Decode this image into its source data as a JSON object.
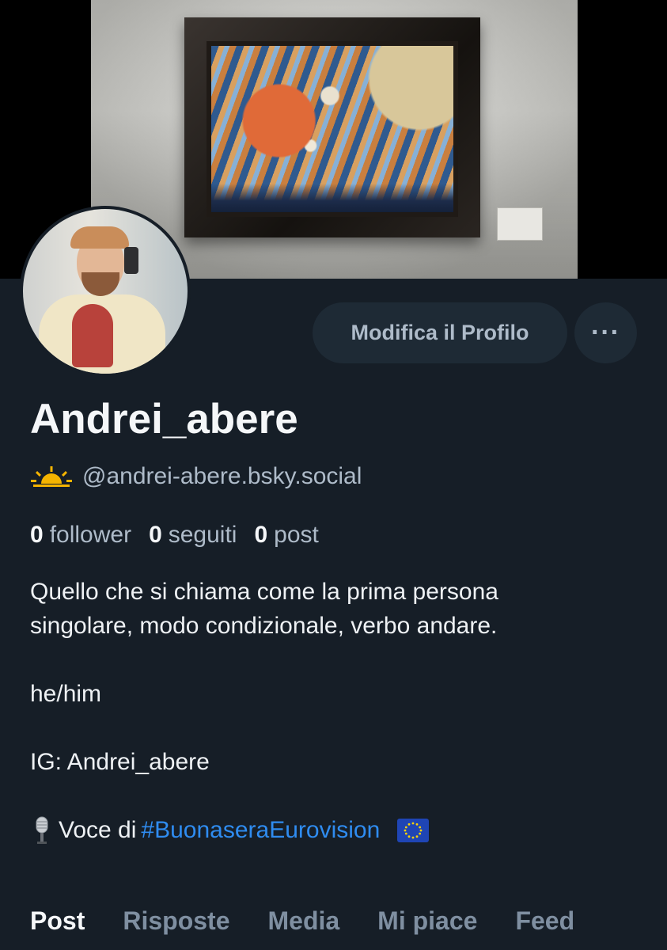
{
  "profile": {
    "display_name": "Andrei_abere",
    "handle": "@andrei-abere.bsky.social",
    "stats": [
      {
        "value": "0",
        "label": "follower"
      },
      {
        "value": "0",
        "label": "seguiti"
      },
      {
        "value": "0",
        "label": "post"
      }
    ],
    "bio": {
      "line1": "Quello che si chiama come la prima persona",
      "line2": "singolare, modo condizionale, verbo andare.",
      "pronouns": "he/him",
      "instagram": "IG: Andrei_abere",
      "voice_prefix": "Voce di",
      "hashtag": "#BuonaseraEurovision"
    }
  },
  "actions": {
    "edit_profile_label": "Modifica il Profilo",
    "more_label": "···"
  },
  "tabs": [
    "Post",
    "Risposte",
    "Media",
    "Mi piace",
    "Feed"
  ],
  "icons": {
    "sun": "sunrise-icon",
    "mic": "microphone-icon",
    "flag": "eu-flag-icon"
  },
  "colors": {
    "background": "#161e27",
    "accent_link": "#2f8cf0",
    "button_bg": "#1e2a35",
    "muted_text": "#aebbc9"
  }
}
